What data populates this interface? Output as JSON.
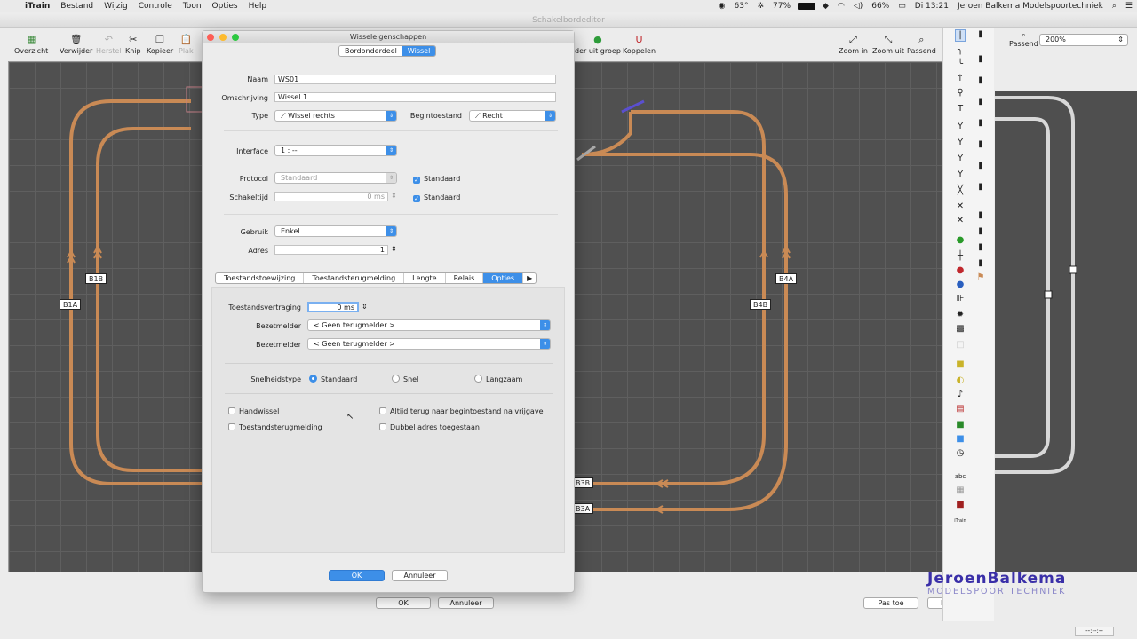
{
  "menubar": {
    "app": "iTrain",
    "items": [
      "Bestand",
      "Wijzig",
      "Controle",
      "Toon",
      "Opties",
      "Help"
    ],
    "status": {
      "temp": "63°",
      "cpu": "77%",
      "wifi": "",
      "volume": "",
      "battery": "66%",
      "clock": "Di 13:21",
      "user": "Jeroen Balkema Modelspoortechniek"
    }
  },
  "window": {
    "title": "Schakelbordeditor"
  },
  "toolbar": {
    "overzicht": "Overzicht",
    "verwijder": "Verwijder",
    "herstel": "Herstel",
    "knip": "Knip",
    "kopieer": "Kopieer",
    "plak": "Plak",
    "uit_groep": "der uit groep",
    "koppelen": "Koppelen",
    "zoom_in": "Zoom in",
    "zoom_uit": "Zoom uit",
    "passend": "Passend"
  },
  "right": {
    "passend": "Passend",
    "zoom": "200%"
  },
  "blocks": {
    "b1a": "B1A",
    "b1b": "B1B",
    "b4a": "B4A",
    "b4b": "B4B",
    "b3b": "B3B",
    "b3a": "B3A"
  },
  "editor_buttons": {
    "ok": "OK",
    "annuleer": "Annuleer",
    "pas_toe": "Pas toe",
    "bewaar": "Bewaar"
  },
  "dialog": {
    "title": "Wisseleigenschappen",
    "seg": [
      "Bordonderdeel",
      "Wissel"
    ],
    "naam_label": "Naam",
    "naam": "WS01",
    "omschrijving_label": "Omschrijving",
    "omschrijving": "Wissel 1",
    "type_label": "Type",
    "type": "Wissel rechts",
    "begin_label": "Begintoestand",
    "begin": "Recht",
    "interface_label": "Interface",
    "interface": "1 : --",
    "protocol_label": "Protocol",
    "protocol": "Standaard",
    "protocol_std": "Standaard",
    "schakeltijd_label": "Schakeltijd",
    "schakeltijd": "0 ms",
    "schakeltijd_std": "Standaard",
    "gebruik_label": "Gebruik",
    "gebruik": "Enkel",
    "adres_label": "Adres",
    "adres": "1",
    "tabs": [
      "Toestandstoewijzing",
      "Toestandsterugmelding",
      "Lengte",
      "Relais",
      "Opties"
    ],
    "vertraging_label": "Toestandsvertraging",
    "vertraging": "0 ms",
    "bezet_label": "Bezetmelder",
    "bezet1": "< Geen terugmelder >",
    "bezet2": "< Geen terugmelder >",
    "snelheid_label": "Snelheidstype",
    "snelheid": [
      "Standaard",
      "Snel",
      "Langzaam"
    ],
    "chk": {
      "handwissel": "Handwissel",
      "terug": "Altijd terug naar begintoestand na vrijgave",
      "terugmelding": "Toestandsterugmelding",
      "dubbel": "Dubbel adres toegestaan"
    },
    "ok": "OK",
    "annuleer": "Annuleer"
  },
  "watermark": {
    "line1": "JeroenBalkema",
    "line2": "MODELSPOOR TECHNIEK"
  },
  "statusbar": "--:--:--",
  "colors": {
    "accent": "#3d8fe8",
    "track": "#c98a55",
    "canvas": "#505050"
  }
}
